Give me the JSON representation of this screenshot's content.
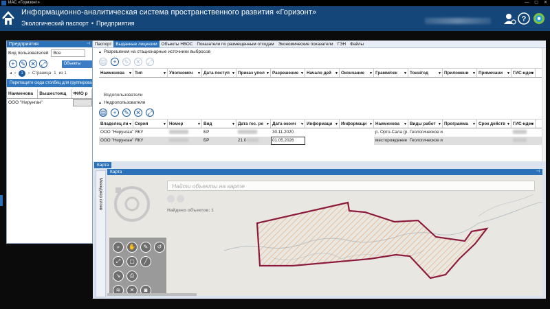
{
  "window": {
    "title": "ИАС «Горизонт»"
  },
  "header": {
    "title": "Информационно-аналитическая система пространственного развития «Горизонт»",
    "breadcrumbs": [
      "Экологический паспорт",
      "Предприятия"
    ]
  },
  "left_panel": {
    "title": "Предприятия",
    "user_view_label": "Вид пользователей",
    "user_view_value": "Все",
    "objects_button": "Объекты пред",
    "pager": {
      "current": "1",
      "page_label": "Страница",
      "page_value": "1",
      "of_label": "из 1"
    },
    "group_hint": "Перетащите сюда столбец для группирова",
    "columns": [
      "Наименова",
      "Вышестоящ",
      "ФИО р"
    ],
    "rows": [
      {
        "name": "ООО \"Нирунган\"",
        "parent": "",
        "fio": ""
      }
    ]
  },
  "tabs": [
    "Паспорт",
    "Выданные лицензии",
    "Объекты НВОС",
    "Показатели по размещенным отходам",
    "Экономические показатели",
    "ГЭН",
    "Файлы"
  ],
  "active_tab": "Выданные лицензии",
  "section_emissions": {
    "title": "Разрешения на стационарные источники выбросов",
    "columns": [
      "Наименова",
      "Тип",
      "Уполномоч",
      "Дата поступ",
      "Приказ упол",
      "Разрешение",
      "Начало дей",
      "Окончание",
      "Грамм/сек",
      "Тонн/год",
      "Приложени",
      "Примечани",
      "ГИС-иден"
    ]
  },
  "section_water": {
    "title": "Водопользователи"
  },
  "section_subsoil": {
    "title": "Недропользователи",
    "columns": [
      "Владелец ли",
      "Серия",
      "Номер",
      "Вид",
      "Дата гос. ре",
      "Дата оконч",
      "Информаци",
      "Информаци",
      "Наименова",
      "Виды работ",
      "Программа",
      "Срок действ",
      "ГИС-иден"
    ],
    "rows": [
      {
        "owner": "ООО \"Нирунган\"",
        "series": "ЯКУ",
        "number": "",
        "kind": "БР",
        "reg_date": "",
        "end_date": "30.11.2020",
        "info1": "",
        "info2": "",
        "name": "р. Орто-Сала (р.",
        "works": "Геологическое и",
        "program": "",
        "term": "",
        "gis": ""
      },
      {
        "owner": "ООО \"Нирунган\"",
        "series": "ЯКУ",
        "number": "",
        "kind": "БР",
        "reg_date": "21.0",
        "end_date": "01.05.2026",
        "info1": "",
        "info2": "",
        "name": "месторождение",
        "works": "Геологическое и",
        "program": "",
        "term": "",
        "gis": ""
      }
    ]
  },
  "map": {
    "tab_label": "Карта",
    "panel_title": "Карта",
    "layers_manager_label": "Менеджер слоев",
    "search_placeholder": "Найти объекты на карте",
    "found_text": "Найдено объектов: 1",
    "polygon_color": "#8c1a3c",
    "tools": [
      "zoom-icon",
      "hand-icon",
      "draw-icon",
      "lasso-icon",
      "extent-icon",
      "select-icon",
      "measure-icon",
      "line-icon",
      "print-icon",
      "layers-icon",
      "clear-icon",
      "camera-icon"
    ]
  },
  "colors": {
    "header": "#14467a",
    "accent": "#2b72b8",
    "tab_active": "#2b72b8"
  }
}
